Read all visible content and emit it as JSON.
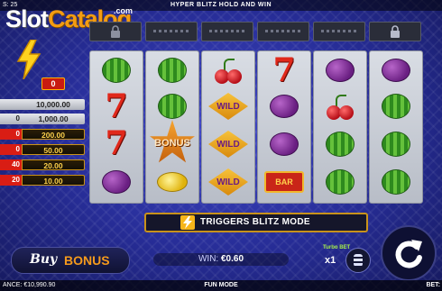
{
  "topbar": {
    "left_text": "S: 25",
    "game_title": "HYPER BLITZ HOLD AND WIN"
  },
  "logo": {
    "slot": "Slot",
    "catalog": "Catalog",
    "com": ".com"
  },
  "bolt_counter": "0",
  "paytable": [
    {
      "mult": "",
      "amount": "10,000.00",
      "style": "grey"
    },
    {
      "mult": "0",
      "amount": "1,000.00",
      "style": "grey"
    },
    {
      "mult": "0",
      "amount": "200.00",
      "style": "gold"
    },
    {
      "mult": "0",
      "amount": "50.00",
      "style": "gold"
    },
    {
      "mult": "40",
      "amount": "20.00",
      "style": "gold"
    },
    {
      "mult": "20",
      "amount": "10.00",
      "style": "gold"
    }
  ],
  "bonus_symbol_text": "BONUS",
  "wild_text": "WILD",
  "bar_text": "BAR",
  "seven_text": "7",
  "blitz_banner": "TRIGGERS BLITZ MODE",
  "buy_bonus": {
    "buy": "Buy",
    "bonus": "BONUS"
  },
  "win": {
    "label": "WIN:",
    "value": "€0.60"
  },
  "turbo": {
    "label": "Turbo BET",
    "mult": "x1"
  },
  "bottombar": {
    "balance": "ANCE: €10,990.90",
    "mode": "FUN MODE",
    "bet": "BET:"
  },
  "colors": {
    "background": "#262c95",
    "accent_gold": "#f1b82b",
    "accent_red": "#c81b10"
  }
}
